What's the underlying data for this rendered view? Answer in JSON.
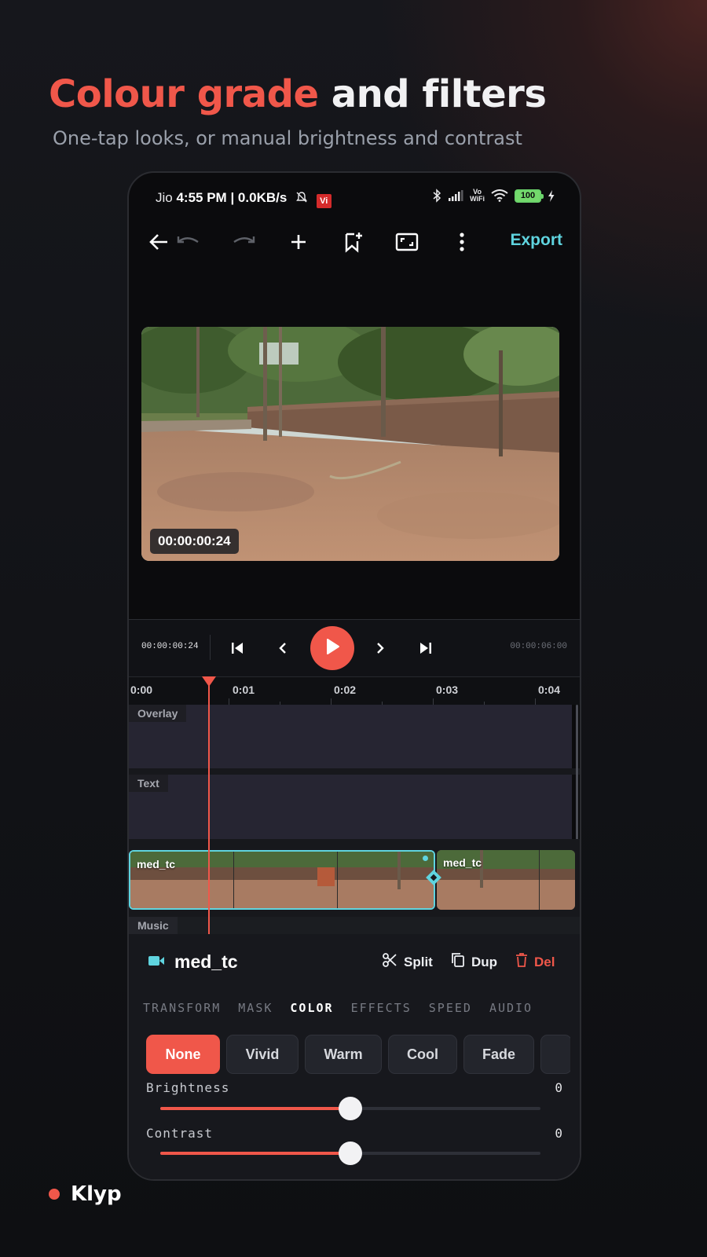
{
  "headline": {
    "accent": "Colour grade",
    "rest": " and filters"
  },
  "subhead": "One-tap looks, or manual brightness and contrast",
  "status_bar": {
    "carrier": "Jio",
    "time": "4:55 PM",
    "speed": "| 0.0KB/s",
    "vi_badge": "Vi",
    "volte": "Vo",
    "wifi_text": "WiFi",
    "battery": "100"
  },
  "toolbar": {
    "export_label": "Export"
  },
  "preview": {
    "timecode": "00:00:00:24"
  },
  "transport": {
    "current_timecode": "00:00:00:24",
    "end_timecode": "00:00:06:00"
  },
  "ruler": {
    "ticks": [
      "0:00",
      "0:01",
      "0:02",
      "0:03",
      "0:04"
    ]
  },
  "tracks": {
    "overlay": "Overlay",
    "text": "Text",
    "music": "Music"
  },
  "clips": [
    {
      "name": "med_tc",
      "selected": true
    },
    {
      "name": "med_tc",
      "selected": false
    }
  ],
  "panel": {
    "clip_name": "med_tc",
    "actions": {
      "split": "Split",
      "dup": "Dup",
      "del": "Del"
    },
    "tabs": [
      "TRANSFORM",
      "MASK",
      "COLOR",
      "EFFECTS",
      "SPEED",
      "AUDIO"
    ],
    "active_tab": "COLOR",
    "presets": [
      "None",
      "Vivid",
      "Warm",
      "Cool",
      "Fade"
    ],
    "active_preset": "None",
    "brightness": {
      "label": "Brightness",
      "value": "0",
      "level": 0.5
    },
    "contrast": {
      "label": "Contrast",
      "value": "0",
      "level": 0.5
    }
  },
  "brand": {
    "name": "Klyp"
  },
  "colors": {
    "accent": "#f0574a",
    "highlight": "#5fd4df",
    "background": "#121317"
  },
  "icons": [
    "back-arrow-icon",
    "undo-icon",
    "redo-icon",
    "add-icon",
    "bookmark-add-icon",
    "aspect-ratio-icon",
    "more-vertical-icon",
    "skip-start-icon",
    "step-back-icon",
    "play-icon",
    "step-forward-icon",
    "skip-end-icon",
    "video-camera-icon",
    "scissors-icon",
    "duplicate-icon",
    "trash-icon",
    "keyframe-icon"
  ]
}
